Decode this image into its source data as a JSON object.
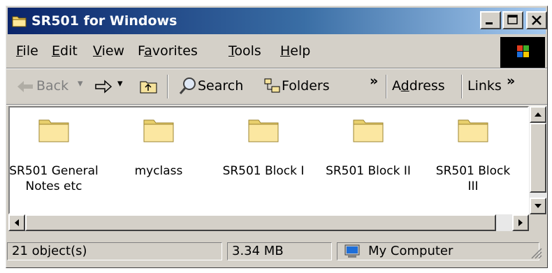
{
  "window": {
    "title": "SR501 for Windows"
  },
  "menu": {
    "file": "F",
    "file_rest": "ile",
    "edit": "E",
    "edit_rest": "dit",
    "view": "V",
    "view_rest": "iew",
    "fav_a": "F",
    "fav_u": "a",
    "fav_rest": "vorites",
    "tools": "T",
    "tools_rest": "ools",
    "help": "H",
    "help_rest": "elp"
  },
  "toolbar": {
    "back": "Back",
    "search": "Search",
    "folders": "Folders",
    "chevron": "»",
    "address_a": "A",
    "address_u": "d",
    "address_rest": "dress",
    "links": "Links",
    "links_chevron": "»"
  },
  "folders": [
    {
      "line1": "SR501 General",
      "line2": "Notes etc"
    },
    {
      "line1": "myclass",
      "line2": ""
    },
    {
      "line1": "SR501 Block I",
      "line2": ""
    },
    {
      "line1": "SR501 Block II",
      "line2": ""
    },
    {
      "line1": "SR501 Block",
      "line2": "III"
    }
  ],
  "status": {
    "objects": "21 object(s)",
    "size": "3.34 MB",
    "location": "My Computer"
  },
  "colors": {
    "title_start": "#0a246a",
    "title_end": "#a6caf0",
    "face": "#d4d0c8",
    "folder": "#f5e29c"
  },
  "icons": {
    "title": "folder-icon",
    "search": "magnifier-icon",
    "folders": "folders-tree-icon",
    "up": "folder-up-icon",
    "computer": "my-computer-icon"
  }
}
